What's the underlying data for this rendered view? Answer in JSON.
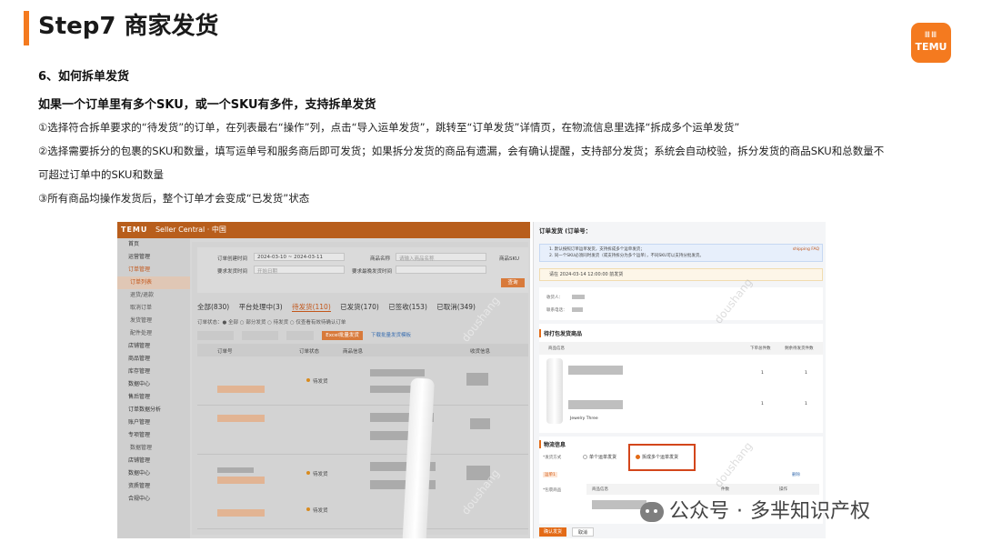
{
  "slide": {
    "title": "Step7 商家发货",
    "section": "6、如何拆单发货",
    "subheading": "如果一个订单里有多个SKU，或一个SKU有多件，支持拆单发货",
    "steps": [
      "①选择符合拆单要求的“待发货”的订单，在列表最右“操作”列，点击“导入运单发货”，跳转至“订单发货”详情页，在物流信息里选择“拆成多个运单发货”",
      "②选择需要拆分的包裹的SKU和数量，填写运单号和服务商后即可发货；如果拆分发货的商品有遗漏，会有确认提醒，支持部分发货；系统会自动校验，拆分发货的商品SKU和总数量不",
      "可超过订单中的SKU和数量",
      "③所有商品均操作发货后，整个订单才会变成“已发货”状态"
    ]
  },
  "logo": {
    "top": "ⅢⅢ",
    "text": "TEMU",
    "color": "#f47a1f"
  },
  "left_shot": {
    "brand": "TEMU",
    "brand_sub": "Seller Central · 中国",
    "sidebar": [
      "首页",
      "运营管理",
      "订单管理",
      "订单列表",
      "退货/退款",
      "取消订单",
      "发货管理",
      "配件处理",
      "店铺管理",
      "商品管理",
      "库存管理",
      "数据中心",
      "售后管理",
      "订单数据分析",
      "账户管理",
      "专项管理",
      "数据管理",
      "店铺管理",
      "数据中心",
      "资质管理",
      "合规中心"
    ],
    "filters": {
      "order_time_label": "订单创建时间",
      "order_time_value": "2024-03-10 ~ 2024-03-11",
      "goods_label": "商品名称",
      "goods_placeholder": "请输入商品名称",
      "sku_label": "商品SKU",
      "ship_time_label": "要求发货时间",
      "ship_time_placeholder": "开始日期",
      "parcel_label": "要求最晚发货时间",
      "query_label": "查询"
    },
    "tabs": [
      "全部(830)",
      "平台处理中(3)",
      "待发货(110)",
      "已发货(170)",
      "已签收(153)",
      "已取消(349)"
    ],
    "active_tab_index": 2,
    "options": "订单状态：● 全部  ○ 部分发货  ○ 待发货  ○ 仅查看有效待确认订单",
    "buttons": {
      "excel": "Excel批量发货",
      "template": "下载批量发货模板"
    },
    "columns": [
      "订单号",
      "订单状态",
      "商品信息",
      "收货信息"
    ],
    "rows": [
      {
        "status": "待发货"
      },
      {
        "status": "待发货"
      },
      {
        "status": "待发货"
      }
    ]
  },
  "right_shot": {
    "title": "订单发货 (订单号：",
    "info_lines": [
      "1. 默认按照订单运单发货，支持拆成多个运单发货；",
      "2. 同一个SKU必须同时发货（或支持拆分为多个运单），不同SKU可以支持分批发货。"
    ],
    "info_link": "shipping FAQ",
    "warning": "请在 2024-03-14 12:00:00 前发货",
    "recipient_label": "收货人：",
    "phone_label": "联系电话：",
    "pending_section": "待打包发货商品",
    "goods_columns": [
      "商品信息",
      "下单总件数",
      "剩余待发货件数"
    ],
    "goods_rows": [
      {
        "ordered": "1",
        "remaining": "1"
      },
      {
        "ordered": "1",
        "remaining": "1"
      }
    ],
    "goods_caption": "Jewelry Three",
    "logistics_section": "物流信息",
    "ship_method_label": "*发货方式",
    "option_single": "单个运单发货",
    "option_split": "拆成多个运单发货",
    "parcel_tag": "运单1",
    "delete_label": "删除",
    "package_label": "*包裹商品",
    "parcel_columns": [
      "商品信息",
      "件数",
      "操作"
    ],
    "confirm_label": "确认发货",
    "cancel_label": "取消"
  },
  "watermark": {
    "prefix": "公众号",
    "name": "多芈知识产权",
    "diag": "doushang"
  }
}
